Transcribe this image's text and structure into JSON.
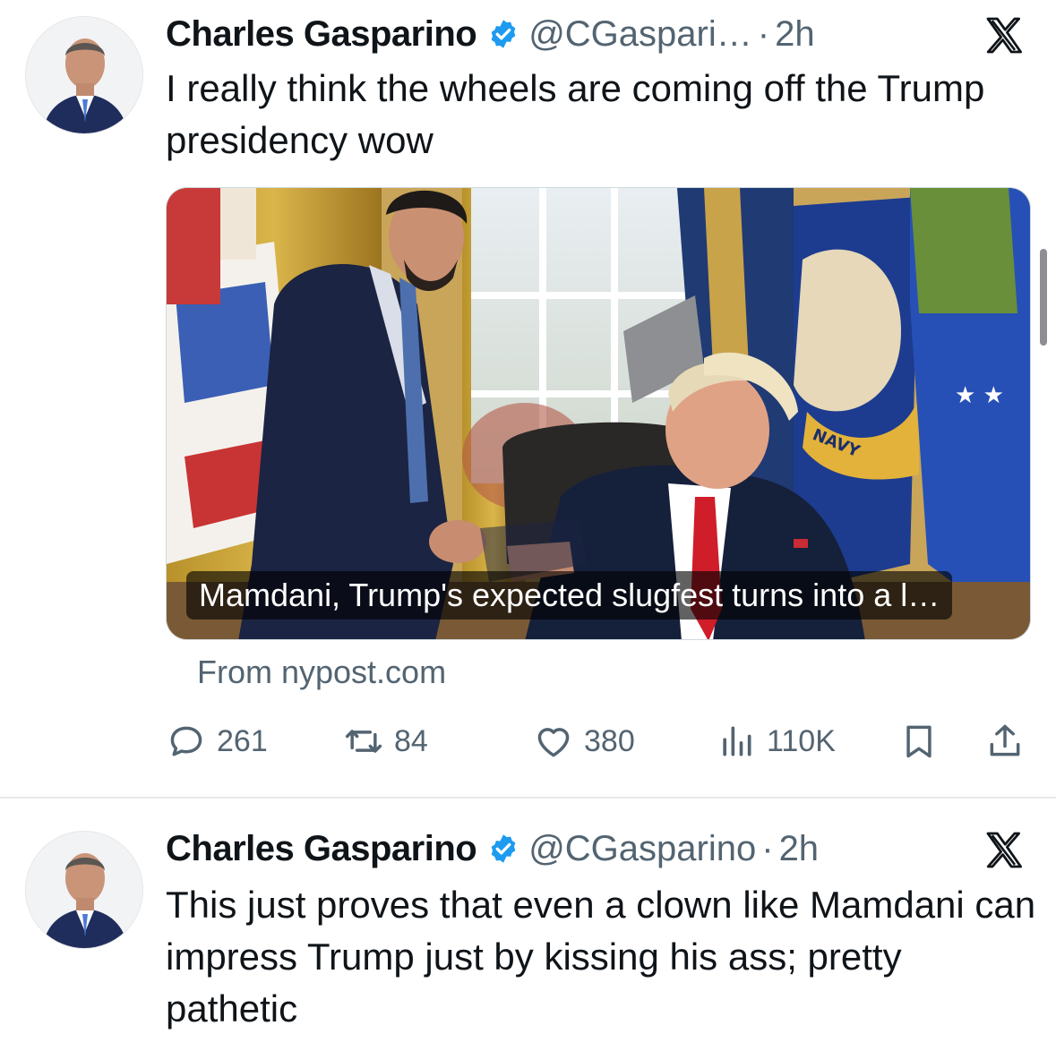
{
  "tweets": [
    {
      "author_name": "Charles Gasparino",
      "handle": "@CGaspari…",
      "separator": "·",
      "time": "2h",
      "text": "I really think the wheels are coming off the Trump presidency wow",
      "card": {
        "caption": "Mamdani, Trump's expected slugfest turns into a l…",
        "source": "From nypost.com",
        "flag_text": "NAVY"
      },
      "actions": {
        "replies": "261",
        "reposts": "84",
        "likes": "380",
        "views": "110K"
      }
    },
    {
      "author_name": "Charles Gasparino",
      "handle": "@CGasparino",
      "separator": "·",
      "time": "2h",
      "text": "This just proves that even a clown like Mamdani can impress Trump just by kissing his ass; pretty pathetic"
    }
  ],
  "icons": {
    "verified": "verified-badge-icon",
    "platform_logo": "x-logo-icon",
    "reply": "reply-icon",
    "repost": "repost-icon",
    "like": "heart-icon",
    "views": "views-icon",
    "bookmark": "bookmark-icon",
    "share": "share-icon"
  },
  "colors": {
    "text_primary": "#0f1419",
    "text_secondary": "#536471",
    "verified_blue": "#1d9bf0",
    "divider": "#e6e9ec"
  }
}
